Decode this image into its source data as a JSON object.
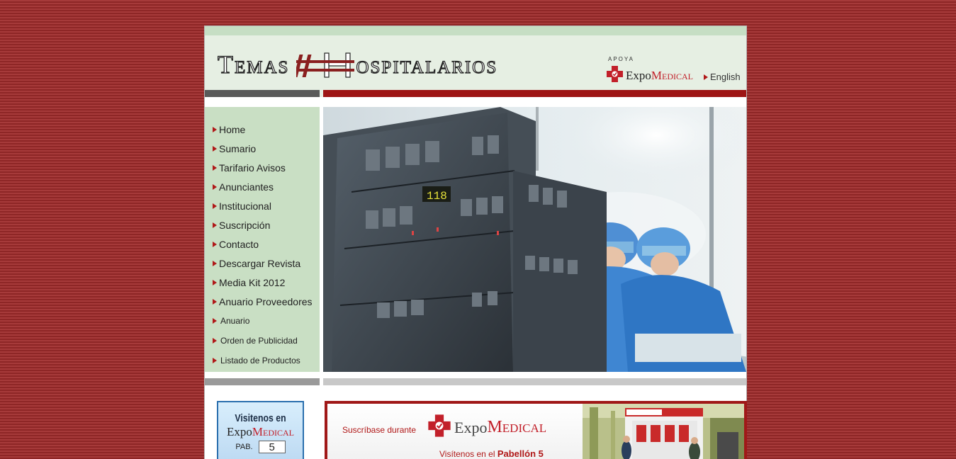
{
  "site": {
    "logo_text_left": "Temas",
    "logo_text_right": "ospitalarios",
    "supports_label": "APOYA",
    "supporter_word": "Expo",
    "supporter_name": "Medical",
    "language_link": "English"
  },
  "sidebar": {
    "items": [
      {
        "label": "Home"
      },
      {
        "label": "Sumario"
      },
      {
        "label": "Tarifario Avisos"
      },
      {
        "label": "Anunciantes"
      },
      {
        "label": "Institucional"
      },
      {
        "label": "Suscripción"
      },
      {
        "label": "Contacto"
      },
      {
        "label": "Descargar Revista"
      },
      {
        "label": "Media Kit 2012"
      },
      {
        "label": "Anuario Proveedores"
      }
    ],
    "sub_items": [
      {
        "label": "Anuario"
      },
      {
        "label": "Orden de Publicidad"
      },
      {
        "label": "Listado de Productos"
      }
    ]
  },
  "visit_badge": {
    "title": "Visitenos en",
    "expo_word": "Expo",
    "expo_name": "Medical",
    "pab_label": "PAB.",
    "pab_number": "5"
  },
  "promo": {
    "subscribe_text": "Suscríbase durante",
    "expo_word": "Expo",
    "expo_name": "Medical",
    "visit_text": "Visítenos en el",
    "pavilion": "Pabellón 5"
  },
  "colors": {
    "background": "#9a2d2d",
    "accent_red": "#9e1515",
    "sidebar_green": "#c9dfc4",
    "header_green": "#e6efe3"
  }
}
